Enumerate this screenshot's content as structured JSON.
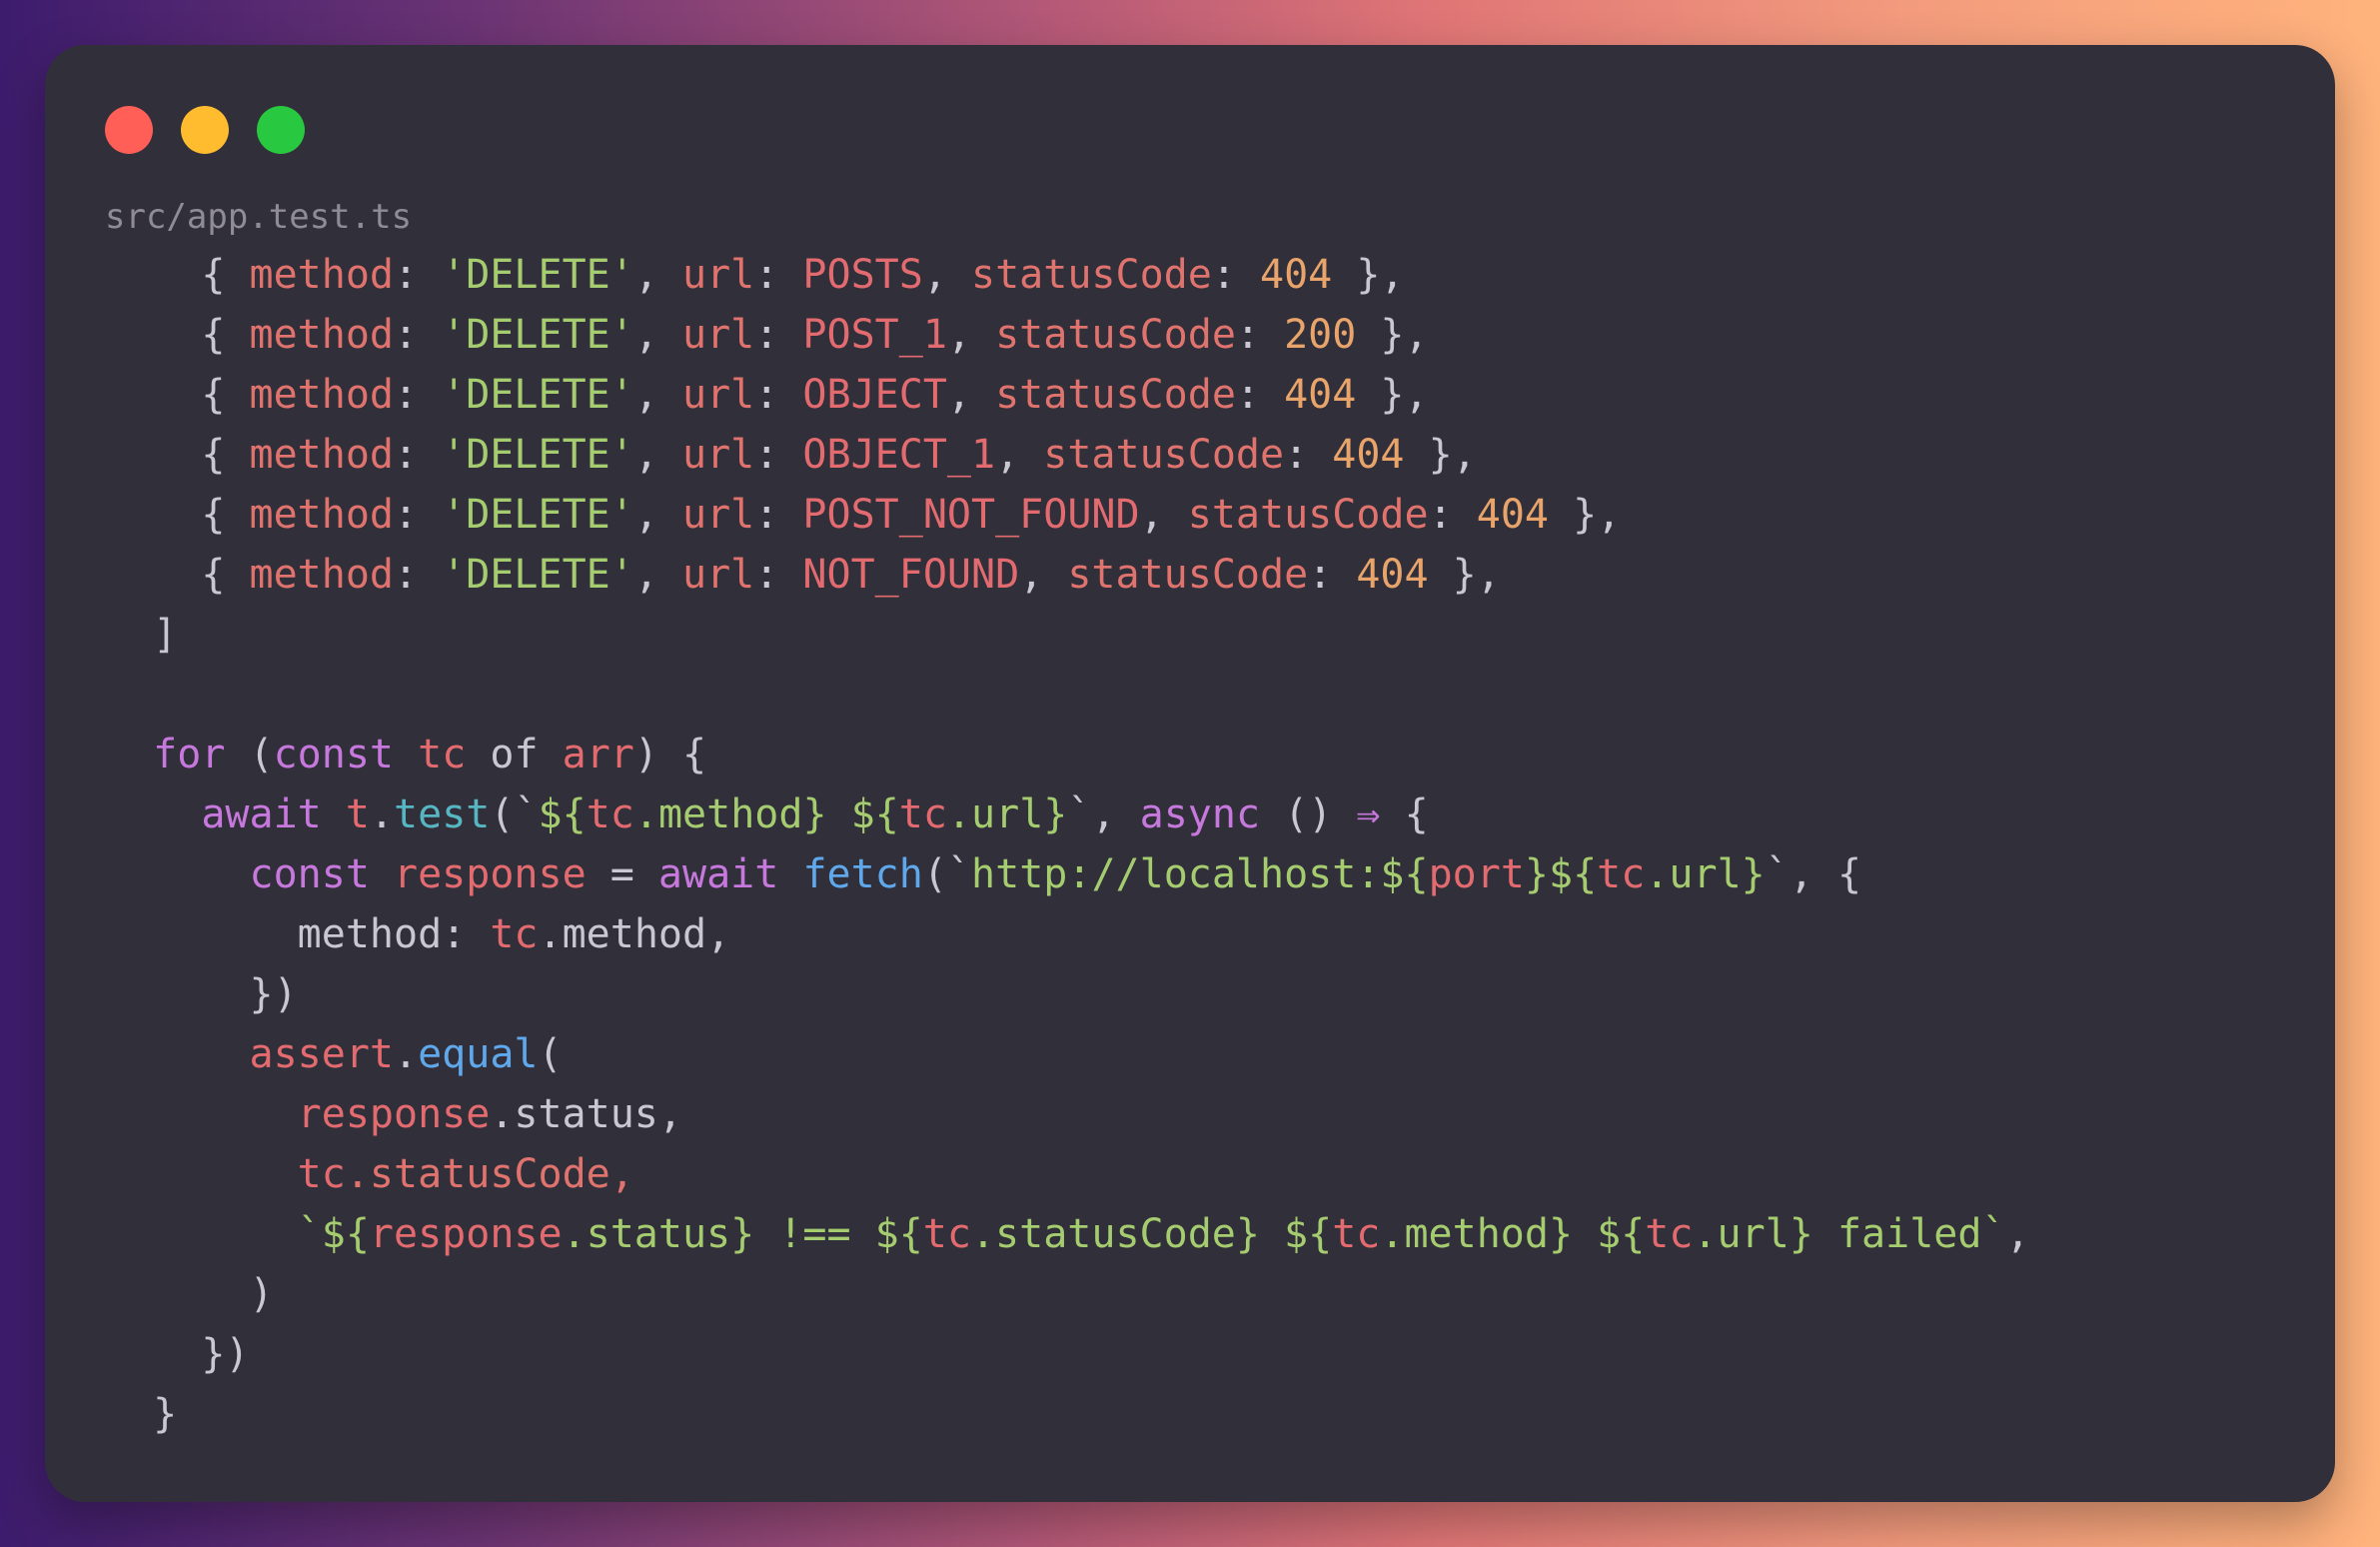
{
  "window": {
    "filename": "src/app.test.ts",
    "colors": {
      "close": "#ff5f57",
      "minimize": "#febc2e",
      "maximize": "#28c840",
      "background": "#31303a"
    }
  },
  "code_lines": [
    [
      {
        "t": "    { ",
        "c": "punc"
      },
      {
        "t": "method",
        "c": "prop"
      },
      {
        "t": ": ",
        "c": "punc"
      },
      {
        "t": "'DELETE'",
        "c": "str"
      },
      {
        "t": ", ",
        "c": "punc"
      },
      {
        "t": "url",
        "c": "prop"
      },
      {
        "t": ": ",
        "c": "punc"
      },
      {
        "t": "POSTS",
        "c": "const"
      },
      {
        "t": ", ",
        "c": "punc"
      },
      {
        "t": "statusCode",
        "c": "prop"
      },
      {
        "t": ": ",
        "c": "punc"
      },
      {
        "t": "404",
        "c": "num"
      },
      {
        "t": " },",
        "c": "punc"
      }
    ],
    [
      {
        "t": "    { ",
        "c": "punc"
      },
      {
        "t": "method",
        "c": "prop"
      },
      {
        "t": ": ",
        "c": "punc"
      },
      {
        "t": "'DELETE'",
        "c": "str"
      },
      {
        "t": ", ",
        "c": "punc"
      },
      {
        "t": "url",
        "c": "prop"
      },
      {
        "t": ": ",
        "c": "punc"
      },
      {
        "t": "POST_1",
        "c": "const"
      },
      {
        "t": ", ",
        "c": "punc"
      },
      {
        "t": "statusCode",
        "c": "prop"
      },
      {
        "t": ": ",
        "c": "punc"
      },
      {
        "t": "200",
        "c": "num"
      },
      {
        "t": " },",
        "c": "punc"
      }
    ],
    [
      {
        "t": "    { ",
        "c": "punc"
      },
      {
        "t": "method",
        "c": "prop"
      },
      {
        "t": ": ",
        "c": "punc"
      },
      {
        "t": "'DELETE'",
        "c": "str"
      },
      {
        "t": ", ",
        "c": "punc"
      },
      {
        "t": "url",
        "c": "prop"
      },
      {
        "t": ": ",
        "c": "punc"
      },
      {
        "t": "OBJECT",
        "c": "const"
      },
      {
        "t": ", ",
        "c": "punc"
      },
      {
        "t": "statusCode",
        "c": "prop"
      },
      {
        "t": ": ",
        "c": "punc"
      },
      {
        "t": "404",
        "c": "num"
      },
      {
        "t": " },",
        "c": "punc"
      }
    ],
    [
      {
        "t": "    { ",
        "c": "punc"
      },
      {
        "t": "method",
        "c": "prop"
      },
      {
        "t": ": ",
        "c": "punc"
      },
      {
        "t": "'DELETE'",
        "c": "str"
      },
      {
        "t": ", ",
        "c": "punc"
      },
      {
        "t": "url",
        "c": "prop"
      },
      {
        "t": ": ",
        "c": "punc"
      },
      {
        "t": "OBJECT_1",
        "c": "const"
      },
      {
        "t": ", ",
        "c": "punc"
      },
      {
        "t": "statusCode",
        "c": "prop"
      },
      {
        "t": ": ",
        "c": "punc"
      },
      {
        "t": "404",
        "c": "num"
      },
      {
        "t": " },",
        "c": "punc"
      }
    ],
    [
      {
        "t": "    { ",
        "c": "punc"
      },
      {
        "t": "method",
        "c": "prop"
      },
      {
        "t": ": ",
        "c": "punc"
      },
      {
        "t": "'DELETE'",
        "c": "str"
      },
      {
        "t": ", ",
        "c": "punc"
      },
      {
        "t": "url",
        "c": "prop"
      },
      {
        "t": ": ",
        "c": "punc"
      },
      {
        "t": "POST_NOT_FOUND",
        "c": "const"
      },
      {
        "t": ", ",
        "c": "punc"
      },
      {
        "t": "statusCode",
        "c": "prop"
      },
      {
        "t": ": ",
        "c": "punc"
      },
      {
        "t": "404",
        "c": "num"
      },
      {
        "t": " },",
        "c": "punc"
      }
    ],
    [
      {
        "t": "    { ",
        "c": "punc"
      },
      {
        "t": "method",
        "c": "prop"
      },
      {
        "t": ": ",
        "c": "punc"
      },
      {
        "t": "'DELETE'",
        "c": "str"
      },
      {
        "t": ", ",
        "c": "punc"
      },
      {
        "t": "url",
        "c": "prop"
      },
      {
        "t": ": ",
        "c": "punc"
      },
      {
        "t": "NOT_FOUND",
        "c": "const"
      },
      {
        "t": ", ",
        "c": "punc"
      },
      {
        "t": "statusCode",
        "c": "prop"
      },
      {
        "t": ": ",
        "c": "punc"
      },
      {
        "t": "404",
        "c": "num"
      },
      {
        "t": " },",
        "c": "punc"
      }
    ],
    [
      {
        "t": "  ]",
        "c": "punc"
      }
    ],
    [],
    [
      {
        "t": "  ",
        "c": "punc"
      },
      {
        "t": "for",
        "c": "kw"
      },
      {
        "t": " (",
        "c": "punc"
      },
      {
        "t": "const",
        "c": "kw"
      },
      {
        "t": " ",
        "c": "punc"
      },
      {
        "t": "tc",
        "c": "var"
      },
      {
        "t": " of ",
        "c": "plain"
      },
      {
        "t": "arr",
        "c": "var"
      },
      {
        "t": ") {",
        "c": "punc"
      }
    ],
    [
      {
        "t": "    ",
        "c": "punc"
      },
      {
        "t": "await",
        "c": "kw"
      },
      {
        "t": " ",
        "c": "punc"
      },
      {
        "t": "t",
        "c": "var"
      },
      {
        "t": ".",
        "c": "punc"
      },
      {
        "t": "test",
        "c": "fn"
      },
      {
        "t": "(`",
        "c": "punc"
      },
      {
        "t": "${",
        "c": "str"
      },
      {
        "t": "tc",
        "c": "var"
      },
      {
        "t": ".method}",
        "c": "str"
      },
      {
        "t": " ",
        "c": "str"
      },
      {
        "t": "${",
        "c": "str"
      },
      {
        "t": "tc",
        "c": "var"
      },
      {
        "t": ".url}",
        "c": "str"
      },
      {
        "t": "`, ",
        "c": "punc"
      },
      {
        "t": "async",
        "c": "kw"
      },
      {
        "t": " () ",
        "c": "punc"
      },
      {
        "t": "⇒",
        "c": "kw"
      },
      {
        "t": " {",
        "c": "punc"
      }
    ],
    [
      {
        "t": "      ",
        "c": "punc"
      },
      {
        "t": "const",
        "c": "kw"
      },
      {
        "t": " ",
        "c": "punc"
      },
      {
        "t": "response",
        "c": "var"
      },
      {
        "t": " = ",
        "c": "punc"
      },
      {
        "t": "await",
        "c": "kw"
      },
      {
        "t": " ",
        "c": "punc"
      },
      {
        "t": "fetch",
        "c": "fn2"
      },
      {
        "t": "(`",
        "c": "punc"
      },
      {
        "t": "http://localhost:${",
        "c": "str"
      },
      {
        "t": "port",
        "c": "var"
      },
      {
        "t": "}${",
        "c": "str"
      },
      {
        "t": "tc",
        "c": "var"
      },
      {
        "t": ".url}",
        "c": "str"
      },
      {
        "t": "`, {",
        "c": "punc"
      }
    ],
    [
      {
        "t": "        method: ",
        "c": "plain"
      },
      {
        "t": "tc",
        "c": "var"
      },
      {
        "t": ".method,",
        "c": "plain"
      }
    ],
    [
      {
        "t": "      })",
        "c": "punc"
      }
    ],
    [
      {
        "t": "      ",
        "c": "punc"
      },
      {
        "t": "assert",
        "c": "var"
      },
      {
        "t": ".",
        "c": "punc"
      },
      {
        "t": "equal",
        "c": "fn2"
      },
      {
        "t": "(",
        "c": "punc"
      }
    ],
    [
      {
        "t": "        ",
        "c": "punc"
      },
      {
        "t": "response",
        "c": "var"
      },
      {
        "t": ".status,",
        "c": "plain"
      }
    ],
    [
      {
        "t": "        ",
        "c": "punc"
      },
      {
        "t": "tc",
        "c": "var"
      },
      {
        "t": ".statusCode,",
        "c": "prop"
      }
    ],
    [
      {
        "t": "        `${",
        "c": "str"
      },
      {
        "t": "response",
        "c": "var"
      },
      {
        "t": ".status}",
        "c": "str"
      },
      {
        "t": " !== ${",
        "c": "str"
      },
      {
        "t": "tc",
        "c": "var"
      },
      {
        "t": ".statusCode}",
        "c": "str"
      },
      {
        "t": " ${",
        "c": "str"
      },
      {
        "t": "tc",
        "c": "var"
      },
      {
        "t": ".method}",
        "c": "str"
      },
      {
        "t": " ${",
        "c": "str"
      },
      {
        "t": "tc",
        "c": "var"
      },
      {
        "t": ".url}",
        "c": "str"
      },
      {
        "t": " failed`",
        "c": "str"
      },
      {
        "t": ",",
        "c": "punc"
      }
    ],
    [
      {
        "t": "      )",
        "c": "punc"
      }
    ],
    [
      {
        "t": "    })",
        "c": "punc"
      }
    ],
    [
      {
        "t": "  }",
        "c": "punc"
      }
    ]
  ]
}
